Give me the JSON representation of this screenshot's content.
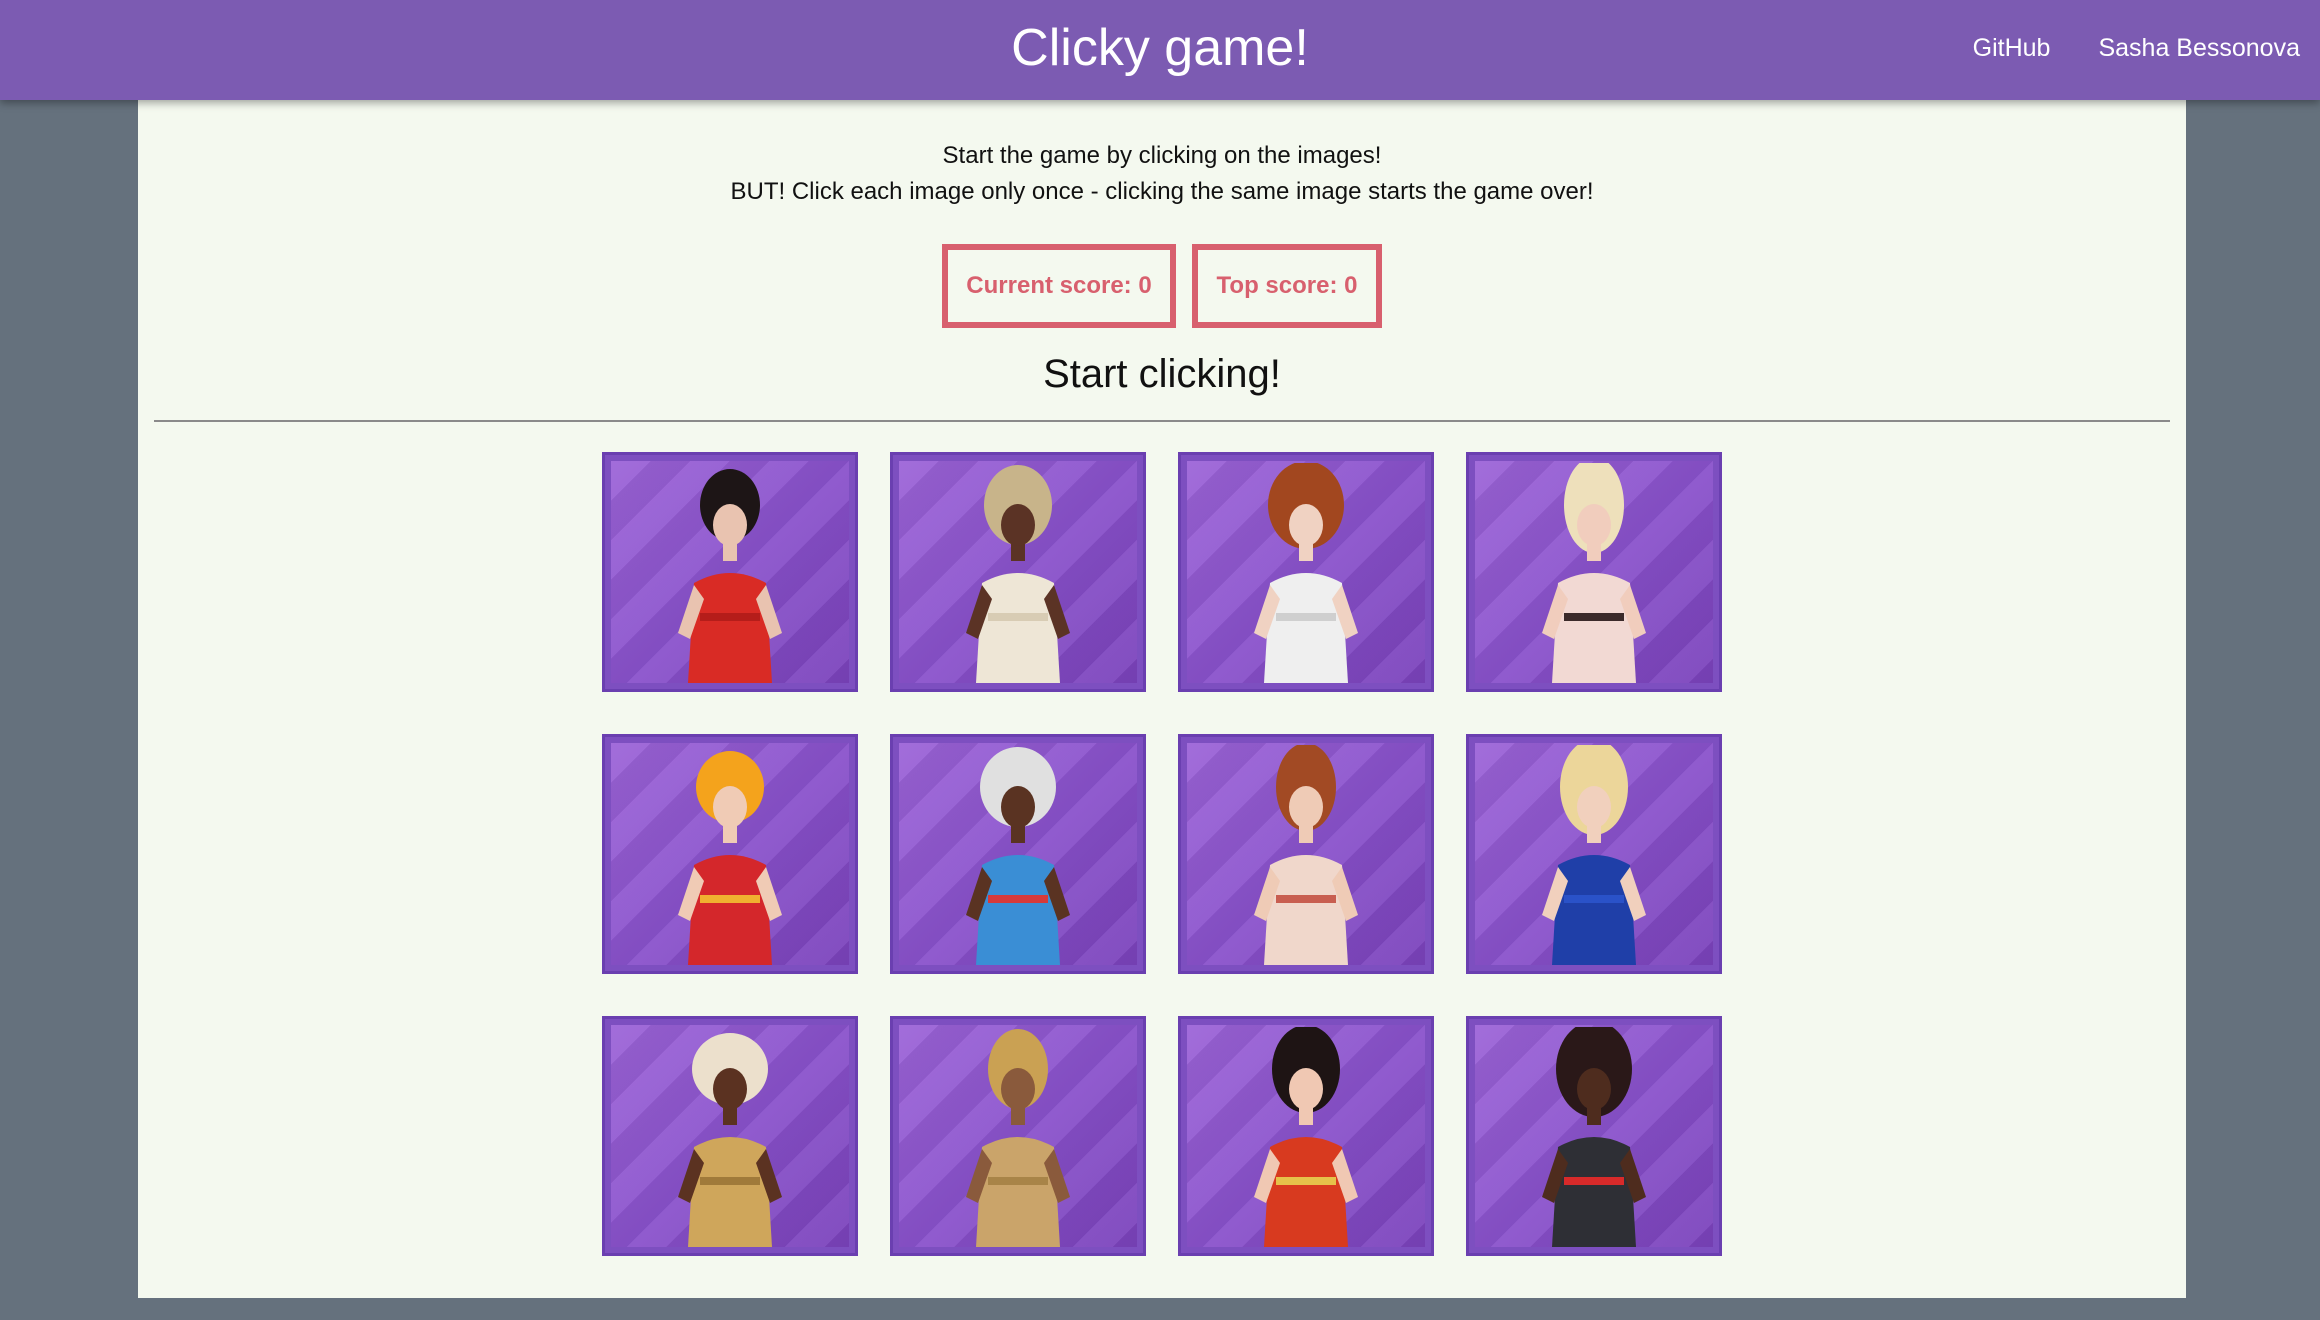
{
  "navbar": {
    "title": "Clicky game!",
    "links": [
      "GitHub",
      "Sasha Bessonova"
    ]
  },
  "instructions": {
    "line1": "Start the game by clicking on the images!",
    "line2": "BUT! Click each image only once - clicking the same image starts the game over!"
  },
  "scores": {
    "current_label": "Current score: 0",
    "top_label": "Top score: 0",
    "current": 0,
    "top": 0
  },
  "status": "Start clicking!",
  "colors": {
    "navbar": "#7c5bb2",
    "page_background": "#65717d",
    "panel": "#f4f9ef",
    "score_accent": "#d8606e",
    "card_background": "#8a52cc"
  },
  "cards": [
    {
      "hair": "#1d1516",
      "skin": "#e9c3b0",
      "outfit": "#d92b25",
      "accent": "#b51d1a"
    },
    {
      "hair": "#c8b48a",
      "skin": "#5b3325",
      "outfit": "#eee6d6",
      "accent": "#d8ccb4"
    },
    {
      "hair": "#a2471f",
      "skin": "#f0d2c2",
      "outfit": "#efefef",
      "accent": "#cfcfcf"
    },
    {
      "hair": "#eee0bb",
      "skin": "#f1cdbd",
      "outfit": "#f2d9d3",
      "accent": "#3b2a2a"
    },
    {
      "hair": "#f4a31c",
      "skin": "#f0cbb5",
      "outfit": "#d4272b",
      "accent": "#f0b030"
    },
    {
      "hair": "#e0e0e0",
      "skin": "#5a3322",
      "outfit": "#3a8ed5",
      "accent": "#d63a3a"
    },
    {
      "hair": "#a24a24",
      "skin": "#efcbb6",
      "outfit": "#f0d7cb",
      "accent": "#c85e50"
    },
    {
      "hair": "#ecd69a",
      "skin": "#f1d0bd",
      "outfit": "#1f3fa8",
      "accent": "#2a52c8"
    },
    {
      "hair": "#ece0cc",
      "skin": "#5b3221",
      "outfit": "#cfa65b",
      "accent": "#a07a3a"
    },
    {
      "hair": "#caa153",
      "skin": "#8a5a3c",
      "outfit": "#caa46a",
      "accent": "#a88448"
    },
    {
      "hair": "#1e1414",
      "skin": "#f0c8b3",
      "outfit": "#d83a1f",
      "accent": "#e6c24a"
    },
    {
      "hair": "#2a1818",
      "skin": "#4e2c1e",
      "outfit": "#2e2f35",
      "accent": "#d82a2a"
    }
  ]
}
